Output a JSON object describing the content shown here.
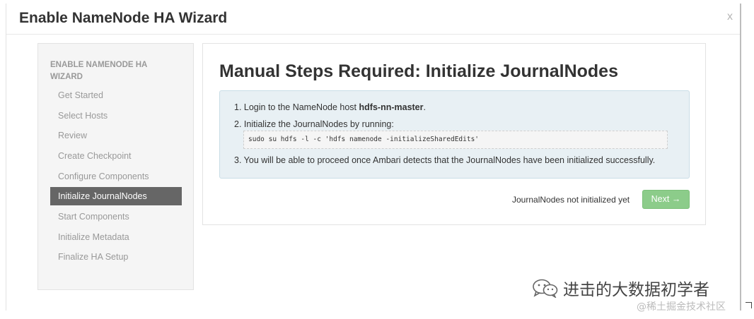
{
  "modal": {
    "title": "Enable NameNode HA Wizard",
    "close_label": "x"
  },
  "sidebar": {
    "heading": "ENABLE NAMENODE HA WIZARD",
    "items": [
      {
        "label": "Get Started",
        "active": false
      },
      {
        "label": "Select Hosts",
        "active": false
      },
      {
        "label": "Review",
        "active": false
      },
      {
        "label": "Create Checkpoint",
        "active": false
      },
      {
        "label": "Configure Components",
        "active": false
      },
      {
        "label": "Initialize JournalNodes",
        "active": true
      },
      {
        "label": "Start Components",
        "active": false
      },
      {
        "label": "Initialize Metadata",
        "active": false
      },
      {
        "label": "Finalize HA Setup",
        "active": false
      }
    ]
  },
  "main": {
    "title": "Manual Steps Required: Initialize JournalNodes",
    "steps": {
      "step1_prefix": "1. Login to the NameNode host ",
      "step1_host": "hdfs-nn-master",
      "step1_suffix": ".",
      "step2": "2. Initialize the JournalNodes by running:",
      "command": "sudo su hdfs -l -c 'hdfs namenode -initializeSharedEdits'",
      "step3": "3. You will be able to proceed once Ambari detects that the JournalNodes have been initialized successfully."
    },
    "status_text": "JournalNodes not initialized yet",
    "next_label": "Next →",
    "next_color": "#8ccc8a"
  },
  "watermark": {
    "main": "进击的大数据初学者",
    "sub": "@稀土掘金技术社区"
  }
}
